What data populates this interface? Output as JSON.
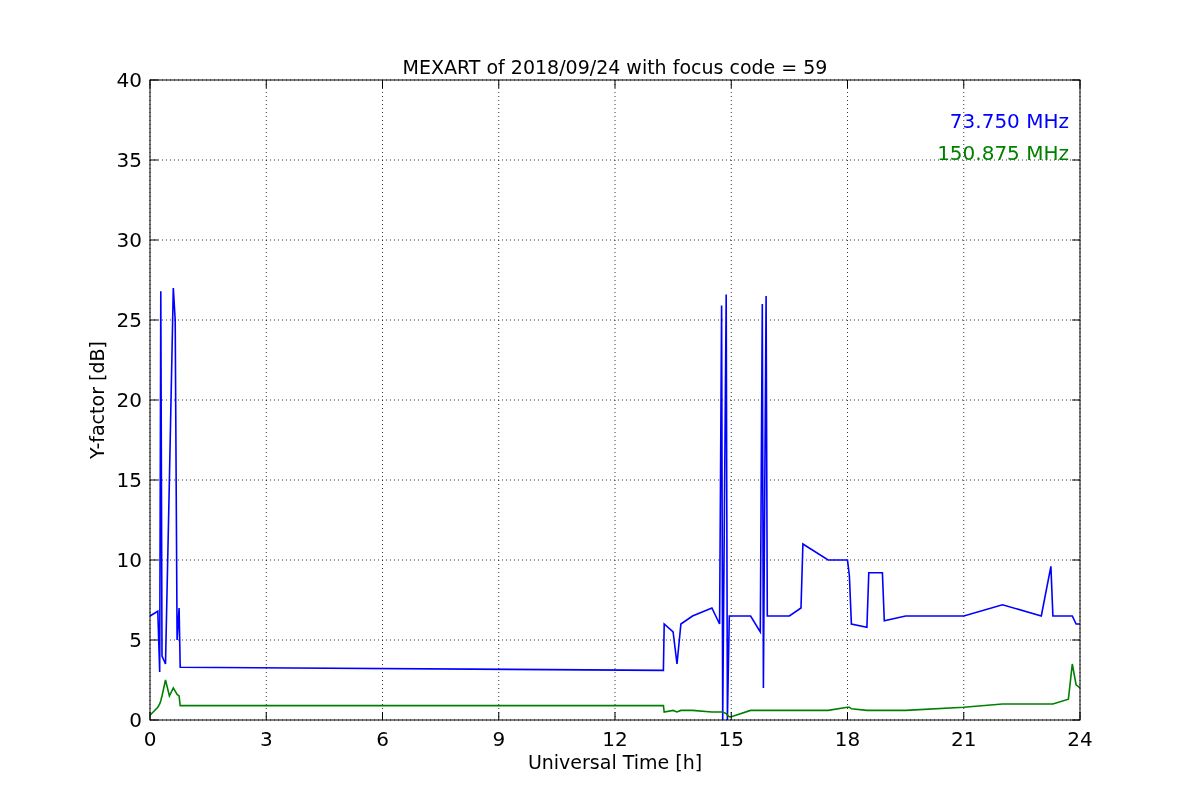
{
  "figure": {
    "chart_data": {
      "type": "line",
      "title": "MEXART of 2018/09/24 with focus code = 59",
      "xlabel": "Universal Time [h]",
      "ylabel": "Y-factor [dB]",
      "x": [
        0,
        0.2,
        0.25,
        0.28,
        0.31,
        0.4,
        0.5,
        0.6,
        0.65,
        0.7,
        0.75,
        0.78,
        13.25,
        13.27,
        13.5,
        13.6,
        13.7,
        14,
        14.5,
        14.7,
        14.75,
        14.78,
        14.87,
        14.9,
        14.95,
        15,
        15.5,
        15.75,
        15.8,
        15.83,
        15.9,
        15.93,
        16.5,
        16.8,
        16.85,
        17.5,
        18,
        18.05,
        18.1,
        18.5,
        18.55,
        18.9,
        18.95,
        19.5,
        21,
        22,
        23,
        23.25,
        23.3,
        23.7,
        23.8,
        23.9,
        24
      ],
      "series": [
        {
          "name": "73.750 MHz",
          "color": "#0000ff",
          "values": [
            6.5,
            6.8,
            3,
            26.8,
            4,
            3.5,
            15,
            27,
            25,
            5,
            7,
            3.3,
            3.1,
            6,
            5.5,
            3.5,
            6,
            6.5,
            7,
            6,
            25.9,
            0,
            26.6,
            0,
            6.5,
            6.5,
            6.5,
            5.5,
            26,
            2,
            26.5,
            6.5,
            6.5,
            7,
            11,
            10,
            10,
            9,
            6,
            5.8,
            9.2,
            9.2,
            6.2,
            6.5,
            6.5,
            7.2,
            6.5,
            9.6,
            6.5,
            6.5,
            6.5,
            6,
            6
          ]
        },
        {
          "name": "150.875 MHz",
          "color": "#008000",
          "values": [
            0.3,
            0.8,
            1,
            1.2,
            1.5,
            2.5,
            1.5,
            2,
            1.8,
            1.6,
            1.5,
            0.9,
            0.9,
            0.5,
            0.6,
            0.5,
            0.6,
            0.6,
            0.5,
            0.5,
            0.5,
            0.5,
            0.4,
            0.3,
            0.2,
            0.2,
            0.6,
            0.6,
            0.6,
            0.6,
            0.6,
            0.6,
            0.6,
            0.6,
            0.6,
            0.6,
            0.8,
            0.8,
            0.7,
            0.6,
            0.6,
            0.6,
            0.6,
            0.6,
            0.8,
            1,
            1,
            1,
            1,
            1.3,
            3.5,
            2.2,
            2
          ]
        }
      ],
      "grid": true,
      "xlim": [
        0,
        24
      ],
      "ylim": [
        0,
        40
      ],
      "xticks": [
        0,
        3,
        6,
        9,
        12,
        15,
        18,
        21,
        24
      ],
      "yticks": [
        0,
        5,
        10,
        15,
        20,
        25,
        30,
        35,
        40
      ]
    }
  }
}
